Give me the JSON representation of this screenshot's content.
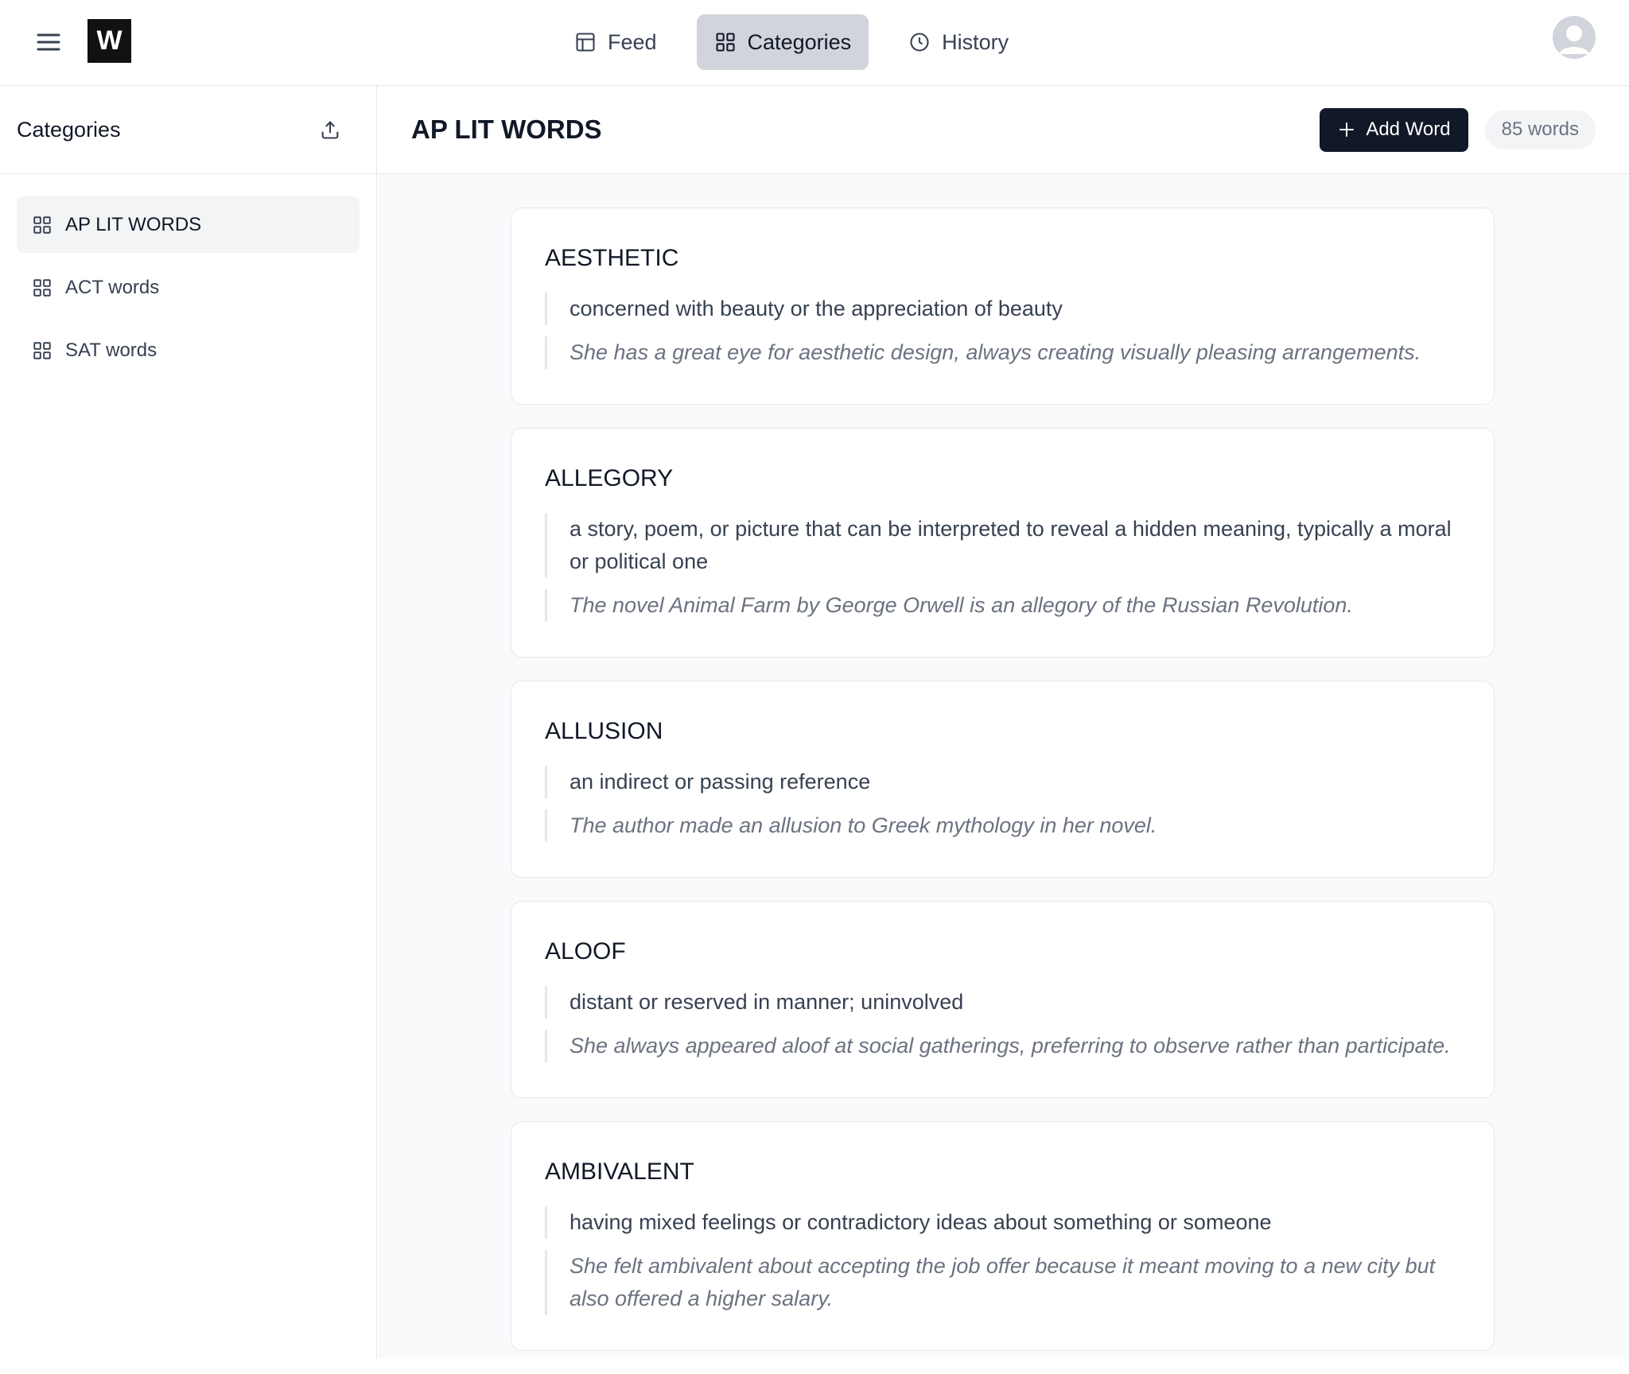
{
  "header": {
    "logo_text": "W",
    "nav": [
      {
        "label": "Feed",
        "icon": "feed-icon",
        "active": false
      },
      {
        "label": "Categories",
        "icon": "grid-icon",
        "active": true
      },
      {
        "label": "History",
        "icon": "clock-icon",
        "active": false
      }
    ]
  },
  "sidebar": {
    "title": "Categories",
    "items": [
      {
        "label": "AP LIT WORDS",
        "active": true
      },
      {
        "label": "ACT words",
        "active": false
      },
      {
        "label": "SAT words",
        "active": false
      }
    ]
  },
  "main": {
    "title": "AP LIT WORDS",
    "add_label": "Add Word",
    "count_label": "85 words",
    "words": [
      {
        "word": "AESTHETIC",
        "definition": "concerned with beauty or the appreciation of beauty",
        "example": "She has a great eye for aesthetic design, always creating visually pleasing arrangements."
      },
      {
        "word": "ALLEGORY",
        "definition": "a story, poem, or picture that can be interpreted to reveal a hidden meaning, typically a moral or political one",
        "example": "The novel Animal Farm by George Orwell is an allegory of the Russian Revolution."
      },
      {
        "word": "ALLUSION",
        "definition": "an indirect or passing reference",
        "example": "The author made an allusion to Greek mythology in her novel."
      },
      {
        "word": "ALOOF",
        "definition": "distant or reserved in manner; uninvolved",
        "example": "She always appeared aloof at social gatherings, preferring to observe rather than participate."
      },
      {
        "word": "AMBIVALENT",
        "definition": "having mixed feelings or contradictory ideas about something or someone",
        "example": "She felt ambivalent about accepting the job offer because it meant moving to a new city but also offered a higher salary."
      }
    ]
  },
  "colors": {
    "accent_dark": "#111827",
    "active_tab_bg": "#d1d5db",
    "page_bg": "#f9fafb"
  }
}
